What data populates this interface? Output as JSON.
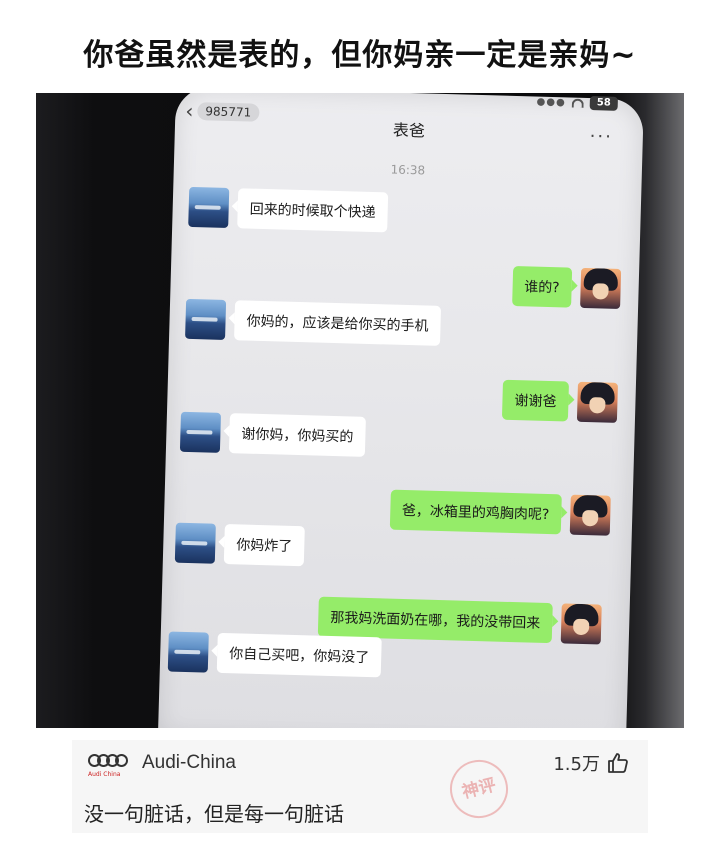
{
  "caption": "你爸虽然是表的，但你妈亲一定是亲妈~",
  "chat": {
    "status_battery": "58",
    "back_badge": "985771",
    "title": "表爸",
    "time": "16:38",
    "messages": [
      {
        "side": "left",
        "text": "回来的时候取个快递"
      },
      {
        "side": "right",
        "text": "谁的?"
      },
      {
        "side": "left",
        "text": "你妈的，应该是给你买的手机"
      },
      {
        "side": "right",
        "text": "谢谢爸"
      },
      {
        "side": "left",
        "text": "谢你妈，你妈买的"
      },
      {
        "side": "right",
        "text": "爸，冰箱里的鸡胸肉呢?"
      },
      {
        "side": "left",
        "text": "你妈炸了"
      },
      {
        "side": "right",
        "text": "那我妈洗面奶在哪，我的没带回来"
      },
      {
        "side": "left",
        "text": "你自己买吧，你妈没了"
      }
    ]
  },
  "comment": {
    "logo_text": "Audi China",
    "username": "Audi-China",
    "likes": "1.5万",
    "text": "没一句脏话，但是每一句脏话",
    "stamp": "神评"
  },
  "icons": {
    "back": "chevron-left-icon",
    "more": "more-icon",
    "like": "thumbs-up-icon",
    "brand": "audi-rings-icon"
  },
  "colors": {
    "sent_bubble": "#95ec69",
    "received_bubble": "#ffffff",
    "chat_background": "#ededf0"
  }
}
